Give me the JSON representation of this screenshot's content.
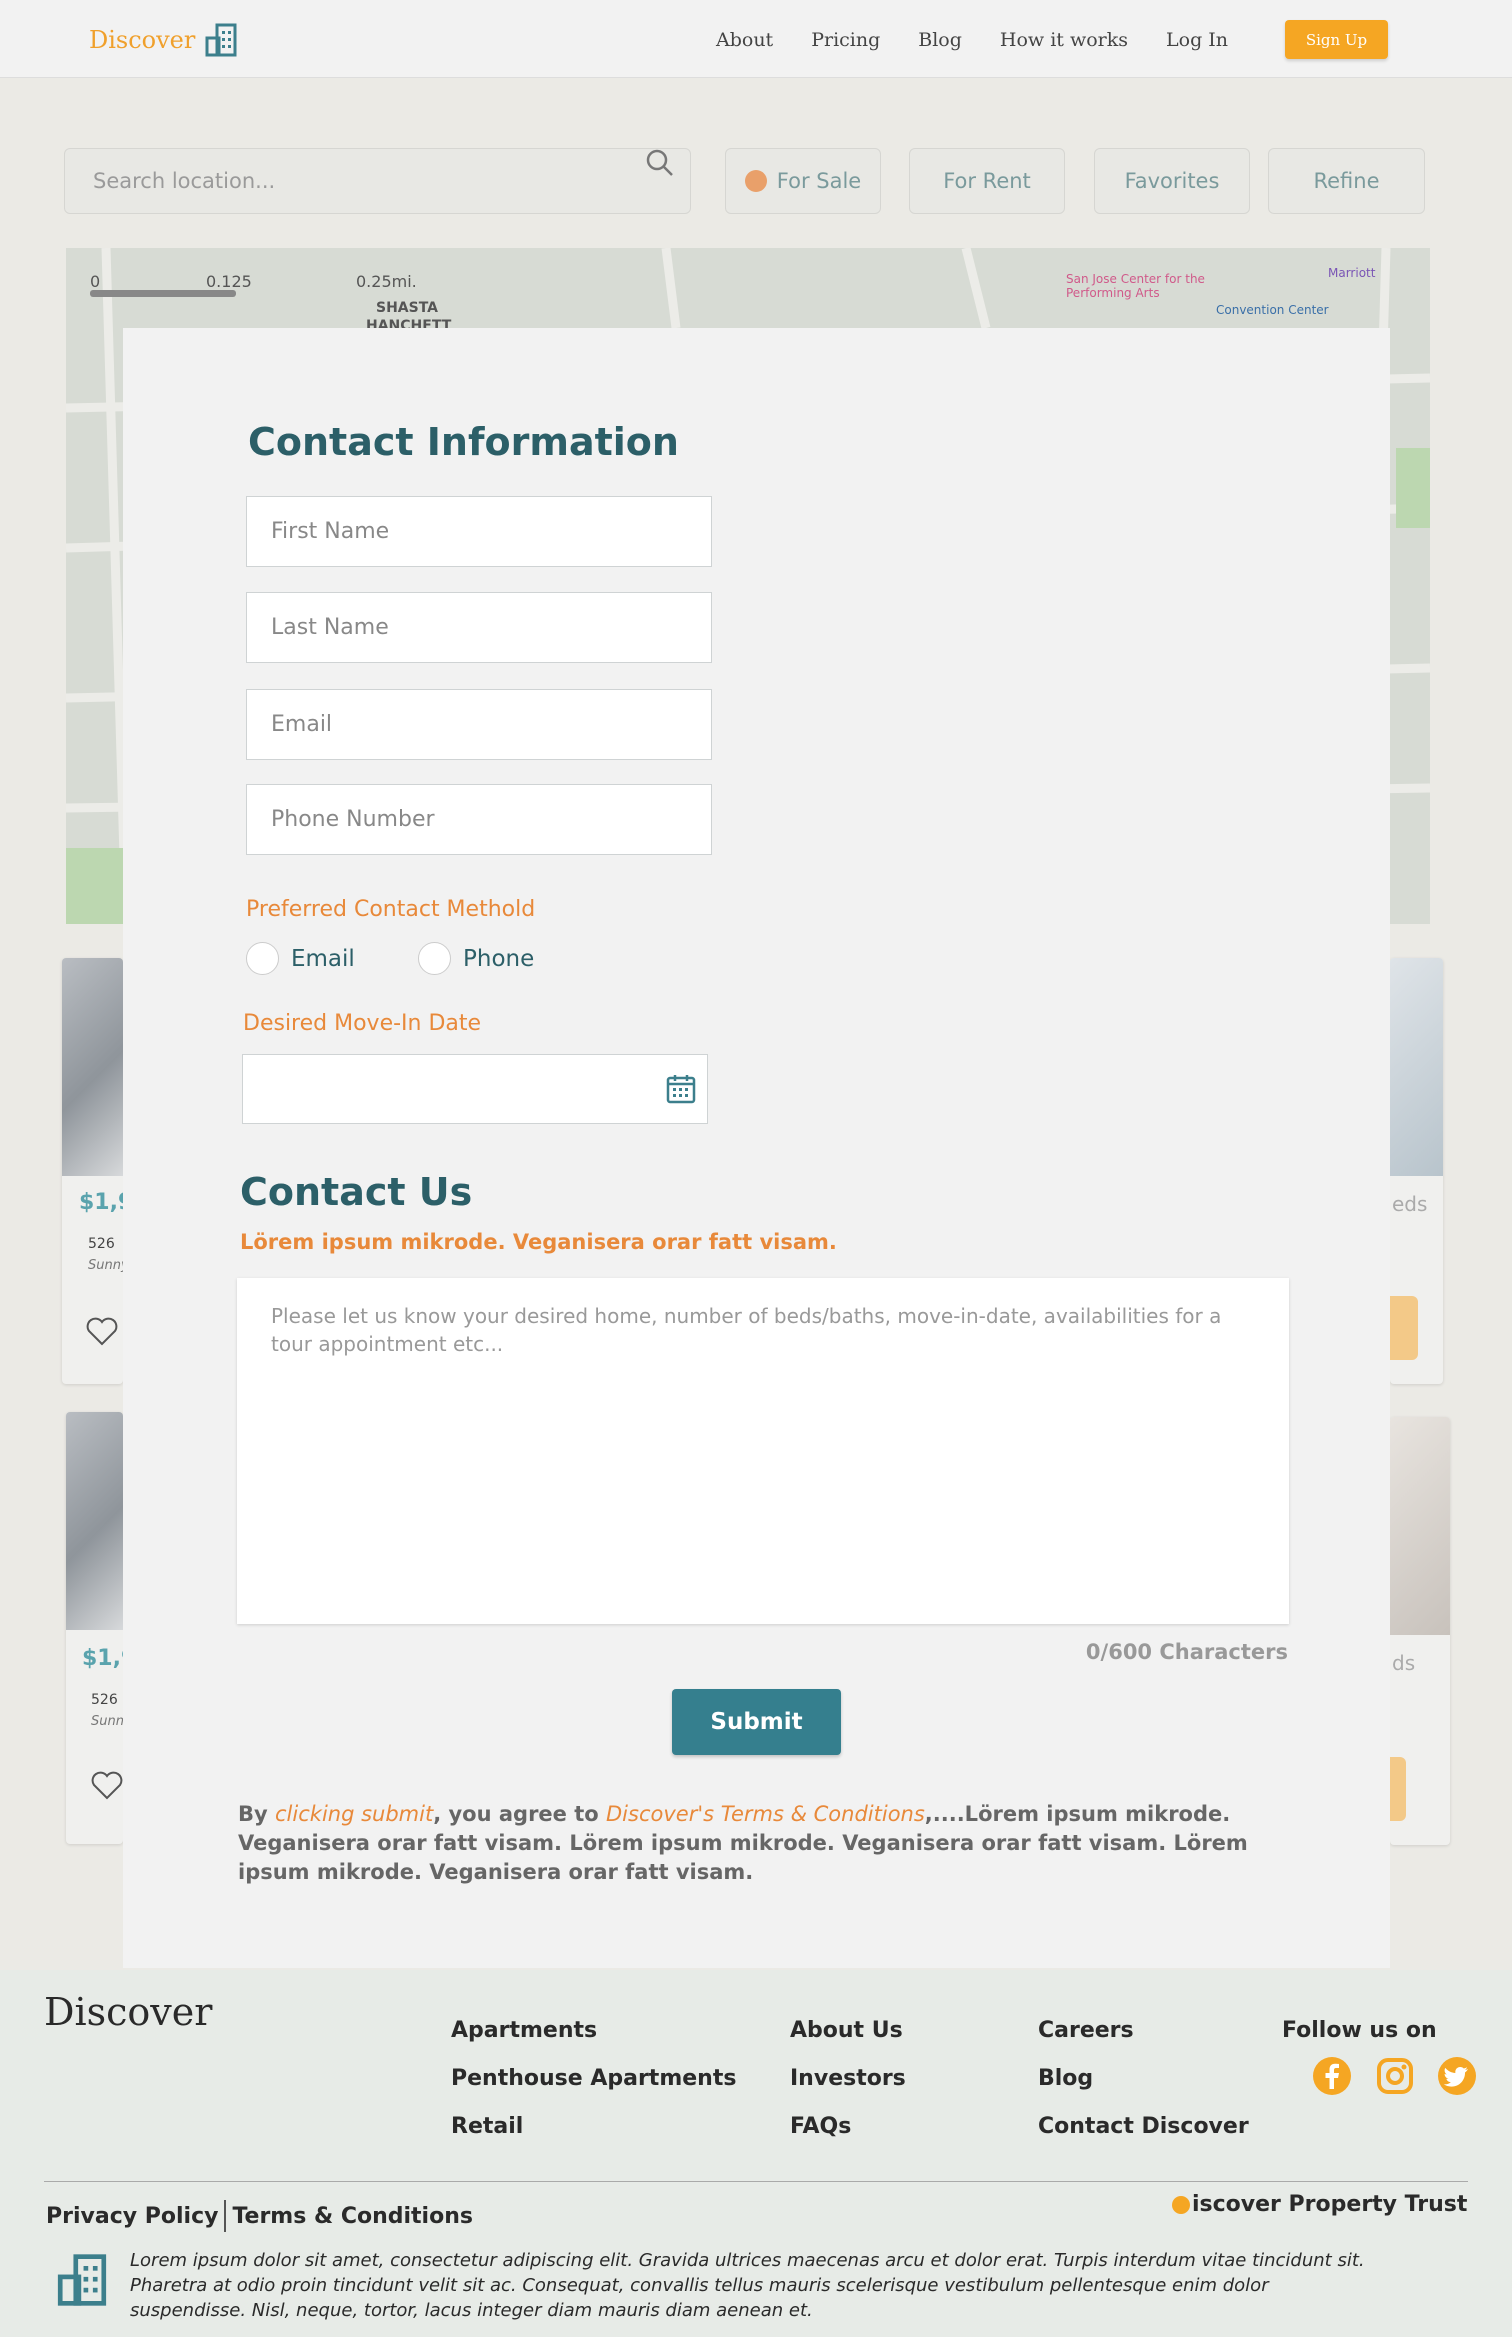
{
  "nav": {
    "brand": "Discover",
    "links": [
      "About",
      "Pricing",
      "Blog",
      "How it works",
      "Log In"
    ],
    "signup": "Sign Up"
  },
  "filters": {
    "search_placeholder": "Search location...",
    "for_sale": "For Sale",
    "for_rent": "For Rent",
    "favorites": "Favorites",
    "refine": "Refine"
  },
  "map": {
    "scale": [
      "0",
      "0.125",
      "0.25mi."
    ],
    "labels": [
      "SHASTA",
      "HANCHETT",
      "San Jose Center for the Performing Arts",
      "Convention Center",
      "Marriott"
    ]
  },
  "listings": {
    "price_fragment": "$1,9",
    "address_fragment": "526",
    "city_fragment": "Sunny",
    "beds_fragment": "eds",
    "beds_fragment_2": "ds"
  },
  "form": {
    "contact_info_title": "Contact Information",
    "first_name": "First Name",
    "last_name": "Last Name",
    "email": "Email",
    "phone": "Phone Number",
    "preferred_label": "Preferred Contact Methold",
    "radio_email": "Email",
    "radio_phone": "Phone",
    "move_in_label": "Desired Move-In Date",
    "contact_us_title": "Contact Us",
    "contact_us_sub": "Lörem ipsum mikrode. Veganisera orar fatt visam.",
    "message_placeholder": "Please let us know your desired home, number of beds/baths, move-in-date, availabilities for a tour appointment etc...",
    "counter": "0/600 Characters",
    "submit": "Submit",
    "terms_prefix": "By ",
    "terms_link1": "clicking submit",
    "terms_mid": ", you agree to ",
    "terms_link2": "Discover's Terms & Conditions",
    "terms_rest": ",....Lörem ipsum mikrode. Veganisera orar fatt visam. Lörem ipsum mikrode. Veganisera orar fatt visam. Lörem ipsum mikrode. Veganisera orar fatt visam."
  },
  "footer": {
    "brand": "Discover",
    "col1": [
      "Apartments",
      "Penthouse Apartments",
      "Retail"
    ],
    "col2": [
      "About Us",
      "Investors",
      "FAQs"
    ],
    "col3": [
      "Careers",
      "Blog",
      "Contact Discover"
    ],
    "follow": "Follow us on",
    "privacy": "Privacy Policy",
    "terms": "Terms & Conditions",
    "trust": "iscover Property Trust",
    "copy": "Lorem ipsum dolor sit amet, consectetur adipiscing elit. Gravida ultrices maecenas arcu et dolor erat. Turpis interdum vitae tincidunt sit. Pharetra at odio proin tincidunt velit sit ac. Consequat, convallis tellus mauris scelerisque vestibulum pellentesque enim dolor suspendisse. Nisl, neque, tortor, lacus integer diam mauris diam aenean et."
  },
  "colors": {
    "accent_orange": "#f5a623",
    "teal": "#2c5f68",
    "submit": "#357f8e"
  }
}
